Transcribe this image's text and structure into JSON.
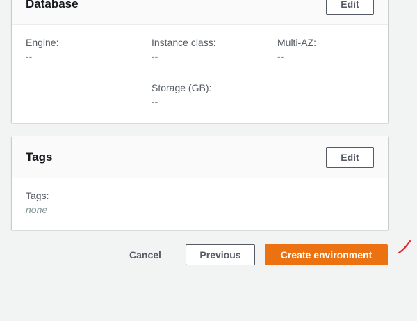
{
  "database": {
    "title": "Database",
    "edit_label": "Edit",
    "fields": {
      "engine": {
        "label": "Engine:",
        "value": "--"
      },
      "instance_class": {
        "label": "Instance class:",
        "value": "--"
      },
      "storage": {
        "label": "Storage (GB):",
        "value": "--"
      },
      "multi_az": {
        "label": "Multi-AZ:",
        "value": "--"
      }
    }
  },
  "tags": {
    "title": "Tags",
    "edit_label": "Edit",
    "field": {
      "label": "Tags:",
      "value": "none"
    }
  },
  "footer": {
    "cancel_label": "Cancel",
    "previous_label": "Previous",
    "create_label": "Create environment"
  },
  "colors": {
    "primary": "#ec7211",
    "annotation_mark": "#e0262c"
  }
}
